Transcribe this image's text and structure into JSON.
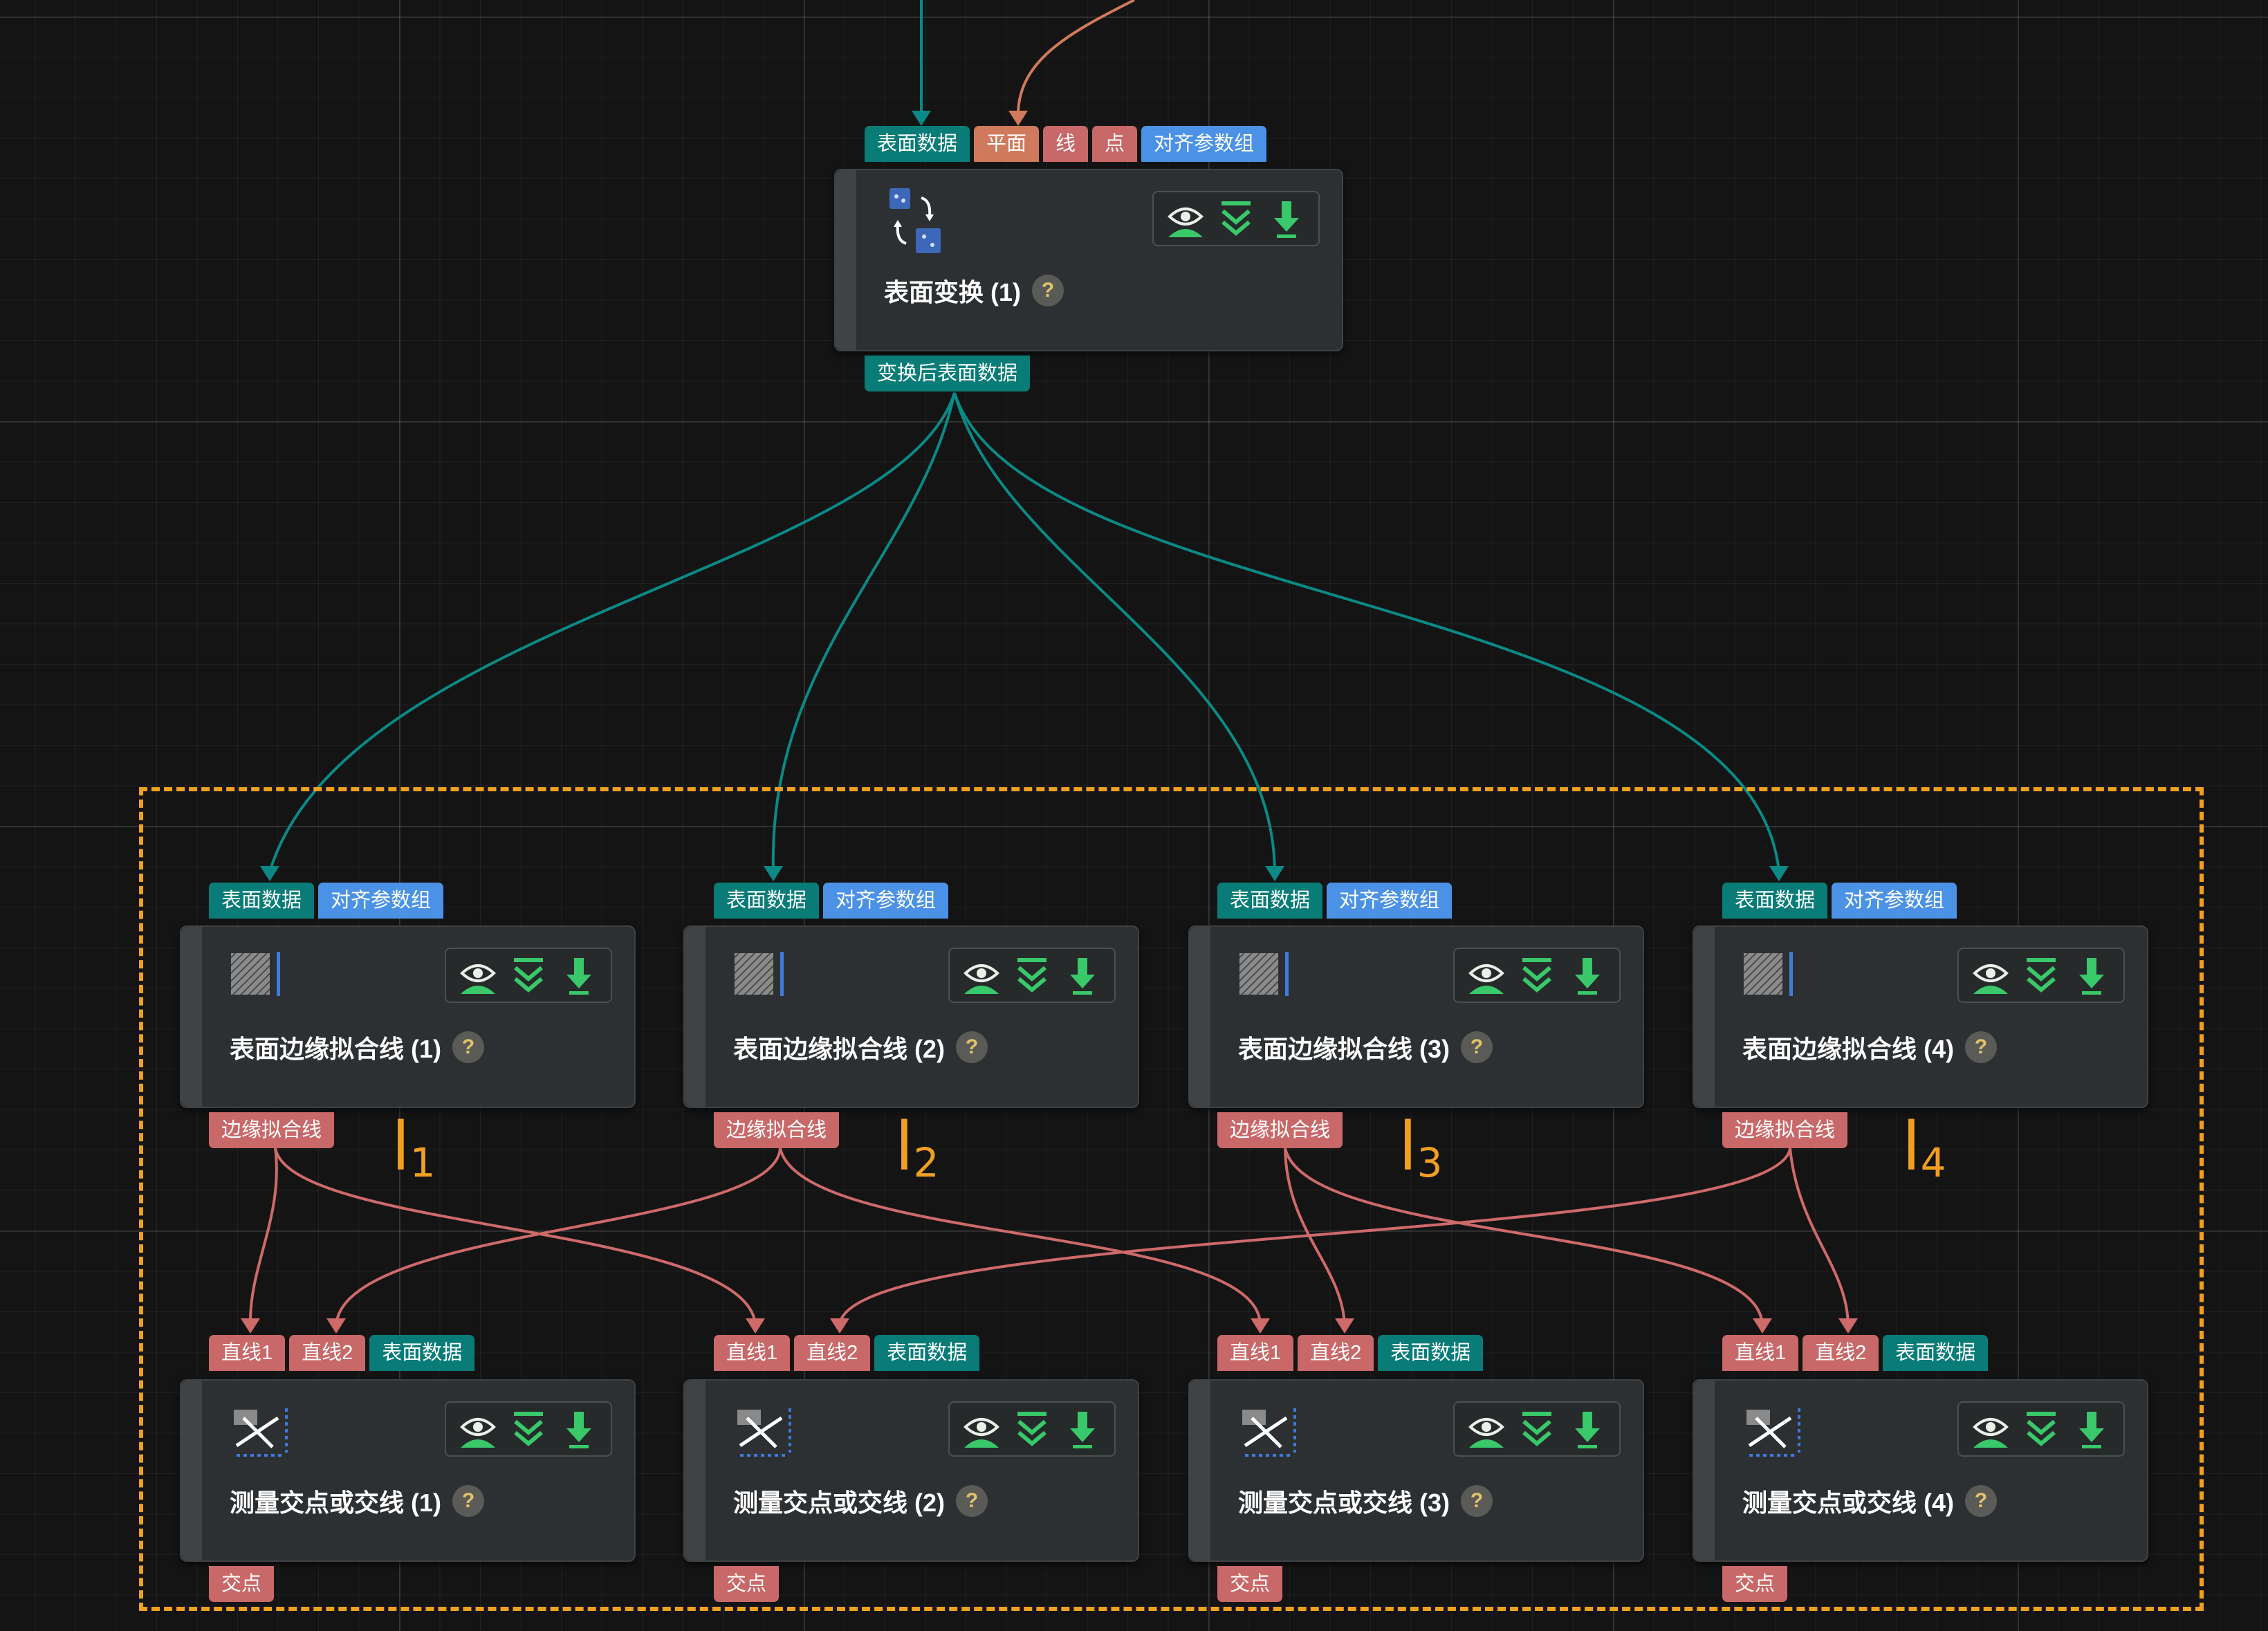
{
  "colors": {
    "surface_wire": "#0a8a86",
    "line_wire": "#cf6a6a",
    "plane_wire": "#cf7a5c",
    "group_frame": "#f0a020"
  },
  "ports": {
    "surface_data": "表面数据",
    "plane": "平面",
    "line": "线",
    "point": "点",
    "align_params": "对齐参数组",
    "transformed_surface": "变换后表面数据",
    "edge_fit_line": "边缘拟合线",
    "line1": "直线1",
    "line2": "直线2",
    "intersection": "交点"
  },
  "nodes": {
    "transform": {
      "title": "表面变换 (1)",
      "icon": "surface-transform-icon"
    },
    "edge_fit": [
      {
        "title": "表面边缘拟合线 (1)"
      },
      {
        "title": "表面边缘拟合线 (2)"
      },
      {
        "title": "表面边缘拟合线 (3)"
      },
      {
        "title": "表面边缘拟合线 (4)"
      }
    ],
    "measure": [
      {
        "title": "测量交点或交线 (1)"
      },
      {
        "title": "测量交点或交线 (2)"
      },
      {
        "title": "测量交点或交线 (3)"
      },
      {
        "title": "测量交点或交线 (4)"
      }
    ],
    "edge_icon": "edge-fit-icon",
    "measure_icon": "intersection-measure-icon",
    "help_label": "?"
  },
  "toolbar_icons": [
    "eye-icon",
    "collapse-icon",
    "download-icon"
  ],
  "annotations": {
    "letter": "l",
    "labels": [
      "1",
      "2",
      "3",
      "4"
    ]
  }
}
